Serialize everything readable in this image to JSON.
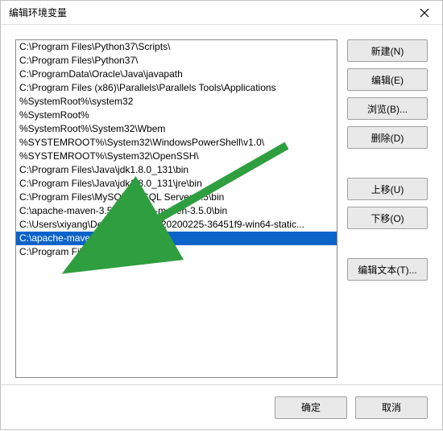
{
  "window": {
    "title": "编辑环境变量"
  },
  "paths": [
    "C:\\Program Files\\Python37\\Scripts\\",
    "C:\\Program Files\\Python37\\",
    "C:\\ProgramData\\Oracle\\Java\\javapath",
    "C:\\Program Files (x86)\\Parallels\\Parallels Tools\\Applications",
    "%SystemRoot%\\system32",
    "%SystemRoot%",
    "%SystemRoot%\\System32\\Wbem",
    "%SYSTEMROOT%\\System32\\WindowsPowerShell\\v1.0\\",
    "%SYSTEMROOT%\\System32\\OpenSSH\\",
    "C:\\Program Files\\Java\\jdk1.8.0_131\\bin",
    "C:\\Program Files\\Java\\jdk1.8.0_131\\jre\\bin",
    "C:\\Program Files\\MySQL\\MySQL Server 5.5\\bin",
    "C:\\apache-maven-3.5.0\\apache-maven-3.5.0\\bin",
    "C:\\Users\\xiyang\\Desktop\\ffmpeg-20200225-36451f9-win64-static...",
    "C:\\apache-maven-3.5.0\\bin",
    "C:\\Program Files (x86)\\Git\\cmd"
  ],
  "selected_index": 14,
  "buttons": {
    "new": "新建(N)",
    "edit": "编辑(E)",
    "browse": "浏览(B)...",
    "delete": "删除(D)",
    "move_up": "上移(U)",
    "move_down": "下移(O)",
    "edit_text": "编辑文本(T)...",
    "ok": "确定",
    "cancel": "取消"
  },
  "annotation": {
    "arrow_color": "#2f9e3f"
  }
}
